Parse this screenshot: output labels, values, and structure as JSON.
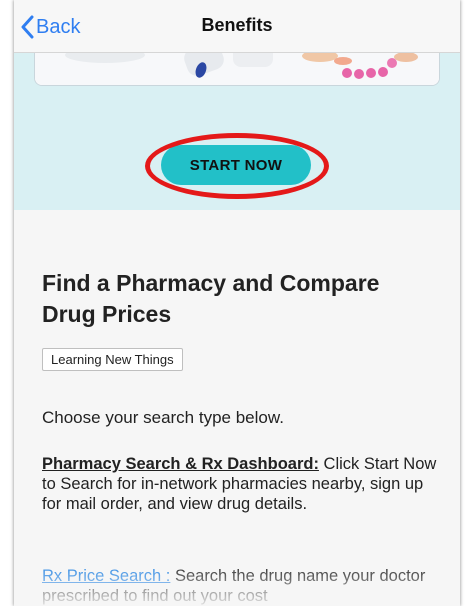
{
  "navbar": {
    "back_label": "Back",
    "title": "Benefits"
  },
  "hero": {
    "start_button_label": "START NOW",
    "highlight_color": "#e41919",
    "button_color": "#22c0c8",
    "background_color": "#d9f0f3"
  },
  "content": {
    "heading": "Find a Pharmacy and Compare Drug Prices",
    "tag": "Learning New Things",
    "intro": "Choose your search type below.",
    "pharmacy_search": {
      "link": "Pharmacy Search & Rx Dashboard:",
      "text": " Click Start Now to Search for in-network pharmacies nearby, sign up for mail order, and view drug details."
    },
    "rx_price_search": {
      "link": "Rx Price Search :",
      "text": " Search the drug name your doctor prescribed to find out your cost"
    },
    "link_color": "#3a8fe4"
  }
}
